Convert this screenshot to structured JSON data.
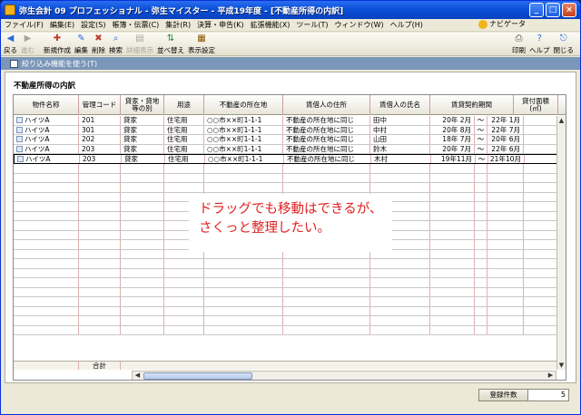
{
  "window": {
    "title": "弥生会計 09 プロフェッショナル - 弥生マイスター - 平成19年度 - [不動産所得の内訳]",
    "min": "_",
    "max": "□",
    "close": "×"
  },
  "menu": {
    "items": [
      "ファイル(F)",
      "編集(E)",
      "設定(S)",
      "帳簿・伝票(C)",
      "集計(R)",
      "決算・申告(K)",
      "拡張機能(X)",
      "ツール(T)",
      "ウィンドウ(W)",
      "ヘルプ(H)"
    ],
    "wizard": "ナビゲータ"
  },
  "toolbar": {
    "back": "戻る",
    "forward": "進む",
    "new": "新規作成",
    "edit": "編集",
    "delete": "削除",
    "search": "検索",
    "detail": "詳細表示",
    "sort": "並べ替え",
    "display": "表示設定",
    "print": "印刷",
    "help": "ヘルプ",
    "close": "閉じる"
  },
  "filter": {
    "label": "絞り込み機能を使う(T)"
  },
  "section": {
    "title": "不動産所得の内訳"
  },
  "table": {
    "headers": [
      "物件名称",
      "管理コード",
      "貸家・貸地\n等の別",
      "用途",
      "不動産の所在地",
      "賃借人の住所",
      "賃借人の氏名",
      "賃貸契約期間",
      "",
      "",
      "貸付面積\n(㎡)"
    ],
    "rows": [
      [
        "ハイツA",
        "201",
        "貸家",
        "住宅用",
        "○○市××町1-1-1",
        "不動産の所在地に同じ",
        "田中",
        "20年 2月",
        "～",
        "22年 1月"
      ],
      [
        "ハイツA",
        "301",
        "貸家",
        "住宅用",
        "○○市××町1-1-1",
        "不動産の所在地に同じ",
        "中村",
        "20年 8月",
        "～",
        "22年 7月"
      ],
      [
        "ハイツA",
        "202",
        "貸家",
        "住宅用",
        "○○市××町1-1-1",
        "不動産の所在地に同じ",
        "山田",
        "18年 7月",
        "～",
        "20年 6月"
      ],
      [
        "ハイツA",
        "203",
        "貸家",
        "住宅用",
        "○○市××町1-1-1",
        "不動産の所在地に同じ",
        "鈴木",
        "20年 7月",
        "～",
        "22年 6月"
      ],
      [
        "ハイツA",
        "203",
        "貸家",
        "住宅用",
        "○○市××町1-1-1",
        "不動産の所在地に同じ",
        "木村",
        "19年11月",
        "～",
        "21年10月"
      ]
    ],
    "total_label": "合計"
  },
  "callout": {
    "line1": "ドラッグでも移動はできるが、",
    "line2": "さくっと整理したい。"
  },
  "status": {
    "label": "登録件数",
    "value": "5"
  },
  "colors": {
    "title_blue": "#0a50d8",
    "filter_bar": "#7a96b8",
    "callout_text": "#e02020"
  }
}
